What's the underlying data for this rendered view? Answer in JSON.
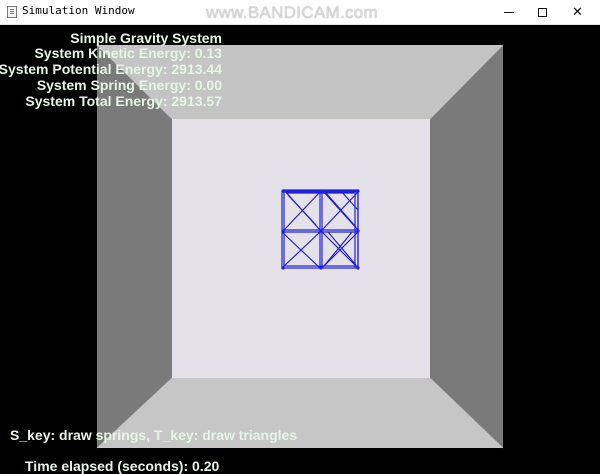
{
  "window": {
    "title": "Simulation Window",
    "watermark": "www.BANDICAM.com",
    "controls": {
      "minimize": "—",
      "maximize": "□",
      "close": "✕"
    }
  },
  "hud": {
    "title": "Simple Gravity System",
    "kinetic": "System Kinetic Energy: 0.13",
    "potential": "System Potential Energy: 2913.44",
    "spring": "System Spring Energy: 0.00",
    "total": "System Total Energy: 2913.57"
  },
  "footer": {
    "keys_hint": "S_key: draw springs, T_key: draw triangles",
    "time": "Time elapsed (seconds): 0.20"
  },
  "colors": {
    "back_wall": "#e4e2e8",
    "side_wall": "#7c7c7c",
    "top_floor": "#c2c2c2",
    "mesh": "#1f1fe0",
    "hud_text": "#e6f5e6"
  }
}
